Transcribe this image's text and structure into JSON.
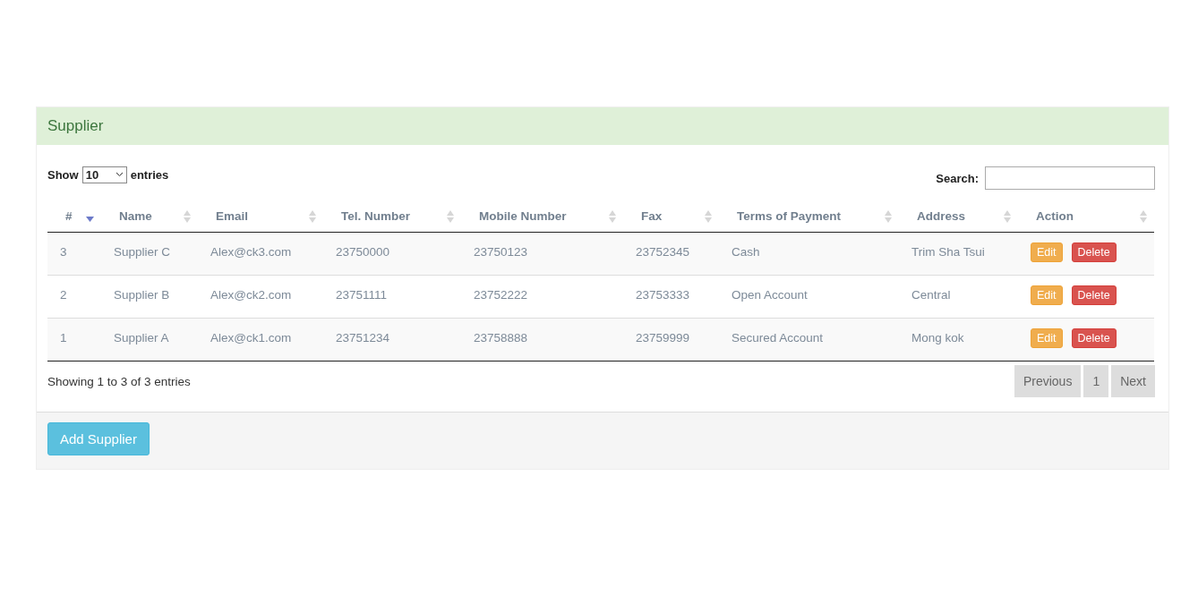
{
  "panel": {
    "title": "Supplier"
  },
  "length_menu": {
    "before": "Show",
    "value": "10",
    "after": "entries"
  },
  "search": {
    "label": "Search:"
  },
  "table": {
    "columns": [
      {
        "label": "#",
        "sorted": true
      },
      {
        "label": "Name",
        "sorted": false
      },
      {
        "label": "Email",
        "sorted": false
      },
      {
        "label": "Tel. Number",
        "sorted": false
      },
      {
        "label": "Mobile Number",
        "sorted": false
      },
      {
        "label": "Fax",
        "sorted": false
      },
      {
        "label": "Terms of Payment",
        "sorted": false
      },
      {
        "label": "Address",
        "sorted": false
      },
      {
        "label": "Action",
        "sorted": false
      }
    ],
    "rows": [
      {
        "cells": [
          "3",
          "Supplier C",
          "Alex@ck3.com",
          "23750000",
          "23750123",
          "23752345",
          "Cash",
          "Trim Sha Tsui"
        ],
        "actions": [
          "Edit",
          "Delete"
        ]
      },
      {
        "cells": [
          "2",
          "Supplier B",
          "Alex@ck2.com",
          "23751111",
          "23752222",
          "23753333",
          "Open Account",
          "Central"
        ],
        "actions": [
          "Edit",
          "Delete"
        ]
      },
      {
        "cells": [
          "1",
          "Supplier A",
          "Alex@ck1.com",
          "23751234",
          "23758888",
          "23759999",
          "Secured Account",
          "Mong kok"
        ],
        "actions": [
          "Edit",
          "Delete"
        ]
      }
    ]
  },
  "info": "Showing 1 to 3 of 3 entries",
  "pagination": [
    "Previous",
    "1",
    "Next"
  ],
  "footer": {
    "button": "Add Supplier"
  }
}
